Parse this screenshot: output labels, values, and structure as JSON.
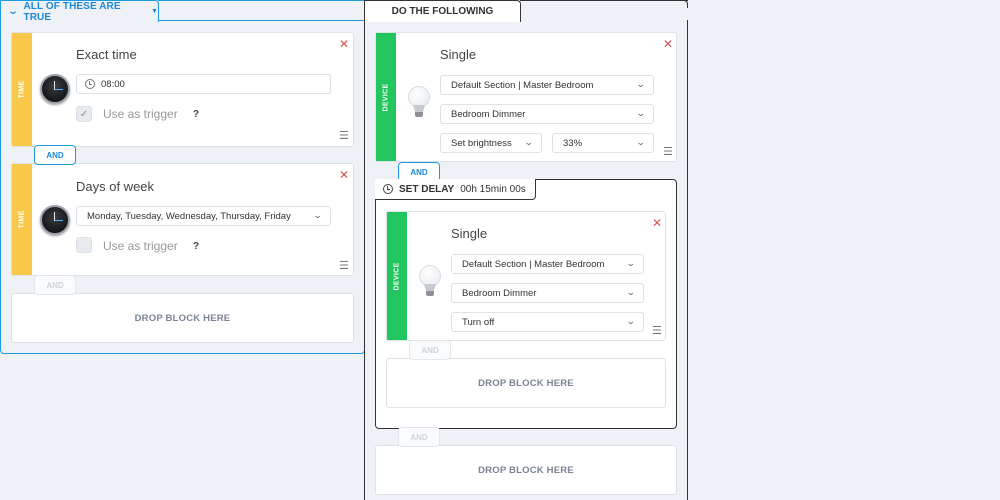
{
  "conditions": {
    "header_label": "ALL OF THESE ARE TRUE",
    "blocks": [
      {
        "category": "TIME",
        "title": "Exact time",
        "field_value": "08:00",
        "trigger_label": "Use as trigger",
        "trigger_checked": true,
        "help": "?"
      },
      {
        "category": "TIME",
        "title": "Days of week",
        "field_value": "Monday, Tuesday, Wednesday, Thursday, Friday",
        "trigger_label": "Use as trigger",
        "trigger_checked": false,
        "help": "?"
      }
    ],
    "connector_label": "AND",
    "drop_label": "DROP BLOCK HERE"
  },
  "actions": {
    "header_label": "DO THE FOLLOWING",
    "blocks": [
      {
        "category": "DEVICE",
        "title": "Single",
        "location": "Default Section | Master Bedroom",
        "device": "Bedroom Dimmer",
        "action": "Set brightness",
        "value": "33%"
      }
    ],
    "delay": {
      "label": "SET DELAY",
      "value": "00h 15min 00s",
      "blocks": [
        {
          "category": "DEVICE",
          "title": "Single",
          "location": "Default Section | Master Bedroom",
          "device": "Bedroom Dimmer",
          "action": "Turn off"
        }
      ],
      "drop_label": "DROP BLOCK HERE"
    },
    "connector_label": "AND",
    "drop_label": "DROP BLOCK HERE"
  },
  "icons": {
    "close": "✕",
    "drag": "☰",
    "dropdown": "⌄",
    "check": "✓",
    "collapse": "⌄",
    "caret": "▼"
  },
  "colors": {
    "accent": "#1e9be0",
    "time_category": "#f9c84a",
    "device_category": "#22c55e",
    "close": "#d9534f"
  }
}
